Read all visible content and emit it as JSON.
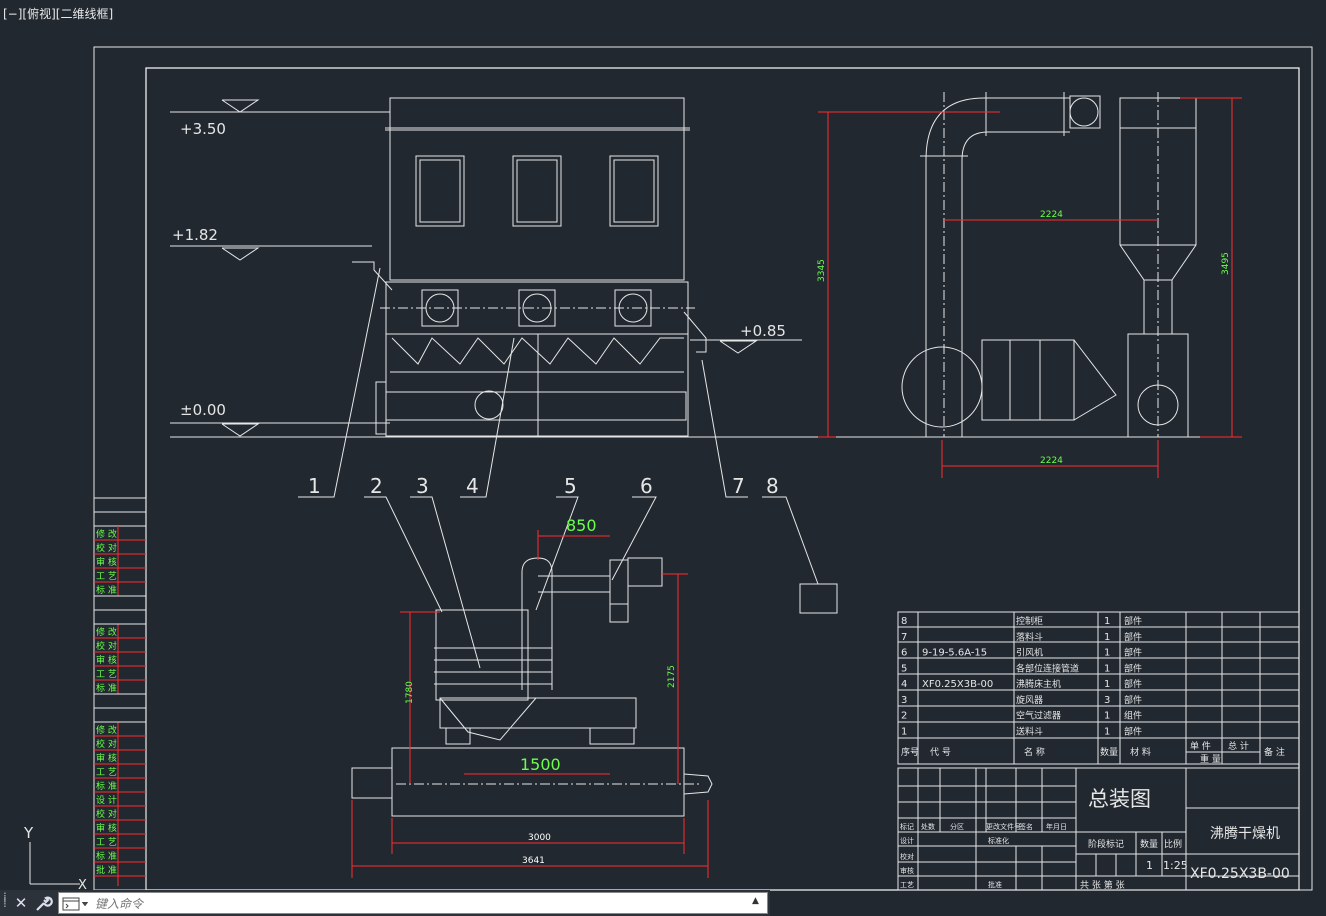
{
  "viewport": {
    "label": "[−][俯视][二维线框]"
  },
  "elevations": {
    "e350": "+3.50",
    "e182": "+1.82",
    "e085": "+0.85",
    "e000": "±0.00"
  },
  "callouts": [
    "1",
    "2",
    "3",
    "4",
    "5",
    "6",
    "7",
    "8"
  ],
  "dimensions": {
    "d2224_top": "2224",
    "d2224_bottom": "2224",
    "d3345": "3345",
    "d3495": "3495",
    "d850": "850",
    "d1500": "1500",
    "d1780": "1780",
    "d2175": "2175",
    "d3000": "3000",
    "d3641": "3641"
  },
  "revision_blocks": [
    [
      "修 改",
      "校 对",
      "审 核",
      "工 艺",
      "标 准"
    ],
    [
      "修 改",
      "校 对",
      "审 核",
      "工 艺",
      "标 准"
    ],
    [
      "修 改",
      "校 对",
      "审 核",
      "工 艺",
      "标 准",
      "设 计",
      "校 对",
      "审 核",
      "工 艺",
      "标 准",
      "批 准"
    ]
  ],
  "bom": {
    "rows": [
      {
        "no": "8",
        "code": "",
        "name": "控制柜",
        "qty": "1",
        "material": "部件"
      },
      {
        "no": "7",
        "code": "",
        "name": "落料斗",
        "qty": "1",
        "material": "部件"
      },
      {
        "no": "6",
        "code": "9-19-5.6A-15",
        "name": "引风机",
        "qty": "1",
        "material": "部件"
      },
      {
        "no": "5",
        "code": "",
        "name": "各部位连接管道",
        "qty": "1",
        "material": "部件"
      },
      {
        "no": "4",
        "code": "XF0.25X3B-00",
        "name": "沸腾床主机",
        "qty": "1",
        "material": "部件"
      },
      {
        "no": "3",
        "code": "",
        "name": "旋风器",
        "qty": "3",
        "material": "部件"
      },
      {
        "no": "2",
        "code": "",
        "name": "空气过滤器",
        "qty": "1",
        "material": "组件"
      },
      {
        "no": "1",
        "code": "",
        "name": "送料斗",
        "qty": "1",
        "material": "部件"
      }
    ],
    "headers": {
      "no": "序号",
      "code": "代  号",
      "name": "名  称",
      "qty": "数量",
      "material": "材  料",
      "single": "单 件",
      "total": "总 计",
      "weight": "重  量",
      "remark": "备 注"
    }
  },
  "title_block": {
    "drawing_title": "总装图",
    "product_name": "沸腾干燥机",
    "drawing_no": "XF0.25X3B-00",
    "stage_label": "阶段标记",
    "weight_label": "数量",
    "scale_label": "比例",
    "qty_value": "1",
    "scale_value": "1:25",
    "sheets": "共  张  第  张",
    "sign_row": [
      "标记",
      "处数",
      "分区",
      "更改文件号",
      "签名",
      "年月日"
    ],
    "roles": [
      "设计",
      "校对",
      "审核",
      "工艺"
    ],
    "std_label": "标准化",
    "approve_label": "批准"
  },
  "ucs": {
    "y": "Y",
    "x": "X"
  },
  "command": {
    "placeholder": "键入命令"
  }
}
